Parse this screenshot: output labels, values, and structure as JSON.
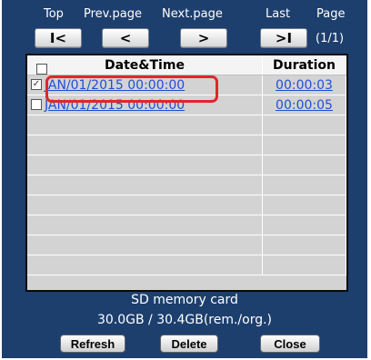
{
  "nav": {
    "top_label": "Top",
    "prev_label": "Prev.page",
    "next_label": "Next.page",
    "last_label": "Last",
    "page_label": "Page",
    "page_count": "(1/1)",
    "top_glyph": "I<",
    "prev_glyph": "<",
    "next_glyph": ">",
    "last_glyph": ">I"
  },
  "table": {
    "col_date": "Date&Time",
    "col_duration": "Duration",
    "rows": [
      {
        "checked": true,
        "date": "JAN/01/2015 00:00:00",
        "duration": "00:00:03"
      },
      {
        "checked": false,
        "date": "JAN/01/2015 00:00:00",
        "duration": "00:00:05"
      }
    ]
  },
  "footer": {
    "storage_label": "SD memory card",
    "capacity": "30.0GB / 30.4GB(rem./org.)",
    "refresh_label": "Refresh",
    "delete_label": "Delete",
    "close_label": "Close"
  },
  "colors": {
    "panel": "#1d3f6e",
    "highlight": "#e0262c",
    "link": "#1f4fd8"
  }
}
